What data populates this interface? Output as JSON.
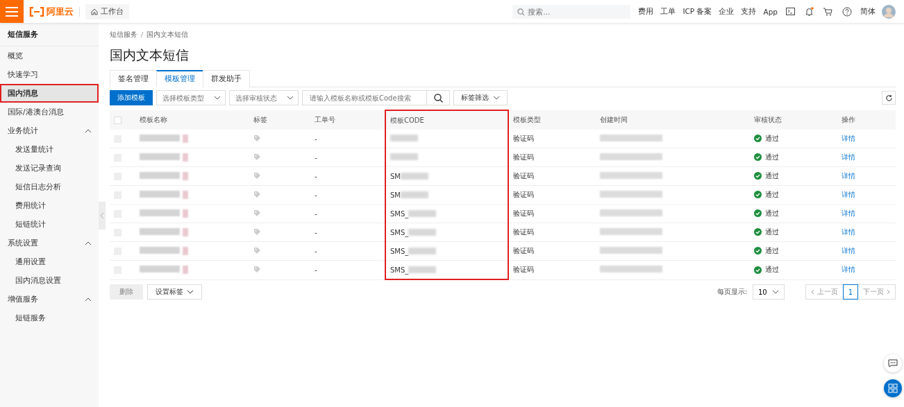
{
  "topbar": {
    "logo": "阿里云",
    "workbench": "工作台",
    "search": {
      "placeholder": "搜索..."
    },
    "links": [
      "费用",
      "工单",
      "ICP 备案",
      "企业",
      "支持",
      "App"
    ],
    "language": "简体",
    "notification_dot": true
  },
  "sidebar": {
    "title": "短信服务",
    "items": [
      {
        "label": "概览",
        "selected": false,
        "highlighted": false
      },
      {
        "label": "快速学习",
        "selected": false,
        "highlighted": false
      },
      {
        "label": "国内消息",
        "selected": true,
        "highlighted": true
      },
      {
        "label": "国际/港澳台消息",
        "selected": false,
        "highlighted": false
      },
      {
        "label": "业务统计",
        "expanded": true,
        "children": [
          {
            "label": "发送量统计",
            "selected": false
          },
          {
            "label": "发送记录查询",
            "selected": false
          },
          {
            "label": "短信日志分析",
            "selected": false
          },
          {
            "label": "费用统计",
            "selected": false
          },
          {
            "label": "短链统计",
            "selected": false
          }
        ]
      },
      {
        "label": "系统设置",
        "expanded": true,
        "children": [
          {
            "label": "通用设置",
            "selected": false
          },
          {
            "label": "国内消息设置",
            "selected": false
          }
        ]
      },
      {
        "label": "增值服务",
        "expanded": true,
        "children": [
          {
            "label": "短链服务",
            "selected": false
          }
        ]
      }
    ]
  },
  "breadcrumb": [
    "短信服务",
    "国内文本短信"
  ],
  "page_title": "国内文本短信",
  "tabs": [
    {
      "label": "签名管理",
      "selected": false
    },
    {
      "label": "模板管理",
      "selected": true
    },
    {
      "label": "群发助手",
      "selected": false
    }
  ],
  "toolbar": {
    "add_button": "添加模板",
    "type_select": {
      "placeholder": "选择模板类型"
    },
    "status_select": {
      "placeholder": "选择审核状态"
    },
    "search": {
      "placeholder": "请输入模板名称或模板Code搜索"
    },
    "tag_filter": "标签筛选"
  },
  "table": {
    "select_all": {
      "checked": false
    },
    "columns": [
      {
        "label": "模板名称",
        "highlighted": false
      },
      {
        "label": "标签",
        "highlighted": false
      },
      {
        "label": "工单号",
        "highlighted": false
      },
      {
        "label": "模板CODE",
        "highlighted": true
      },
      {
        "label": "模板类型",
        "highlighted": false
      },
      {
        "label": "创建时间",
        "highlighted": false
      },
      {
        "label": "审核状态",
        "highlighted": false
      },
      {
        "label": "操作",
        "highlighted": false
      }
    ],
    "rows": [
      {
        "checked": false,
        "checkbox_disabled": true,
        "ticket": "-",
        "code": "",
        "type": "验证码",
        "status": "通过",
        "approved": true,
        "action": "详情"
      },
      {
        "checked": false,
        "checkbox_disabled": true,
        "ticket": "-",
        "code": "",
        "type": "验证码",
        "status": "通过",
        "approved": true,
        "action": "详情"
      },
      {
        "checked": false,
        "checkbox_disabled": true,
        "ticket": "-",
        "code": "SM",
        "type": "验证码",
        "status": "通过",
        "approved": true,
        "action": "详情"
      },
      {
        "checked": false,
        "checkbox_disabled": true,
        "ticket": "-",
        "code": "SM",
        "type": "验证码",
        "status": "通过",
        "approved": true,
        "action": "详情"
      },
      {
        "checked": false,
        "checkbox_disabled": true,
        "ticket": "-",
        "code": "SMS_",
        "type": "验证码",
        "status": "通过",
        "approved": true,
        "action": "详情"
      },
      {
        "checked": false,
        "checkbox_disabled": true,
        "ticket": "-",
        "code": "SMS_",
        "type": "验证码",
        "status": "通过",
        "approved": true,
        "action": "详情"
      },
      {
        "checked": false,
        "checkbox_disabled": true,
        "ticket": "-",
        "code": "SMS_",
        "type": "验证码",
        "status": "通过",
        "approved": true,
        "action": "详情"
      },
      {
        "checked": false,
        "checkbox_disabled": true,
        "ticket": "-",
        "code": "SMS_",
        "type": "验证码",
        "status": "通过",
        "approved": true,
        "action": "详情"
      }
    ]
  },
  "footer": {
    "delete_button": {
      "label": "删除",
      "disabled": true
    },
    "tag_button": "设置标签",
    "page_size_label": "每页显示:",
    "page_size": "10",
    "prev": {
      "label": "上一页",
      "disabled": true
    },
    "pages": [
      {
        "label": "1",
        "selected": true
      }
    ],
    "next": {
      "label": "下一页",
      "disabled": true
    }
  }
}
